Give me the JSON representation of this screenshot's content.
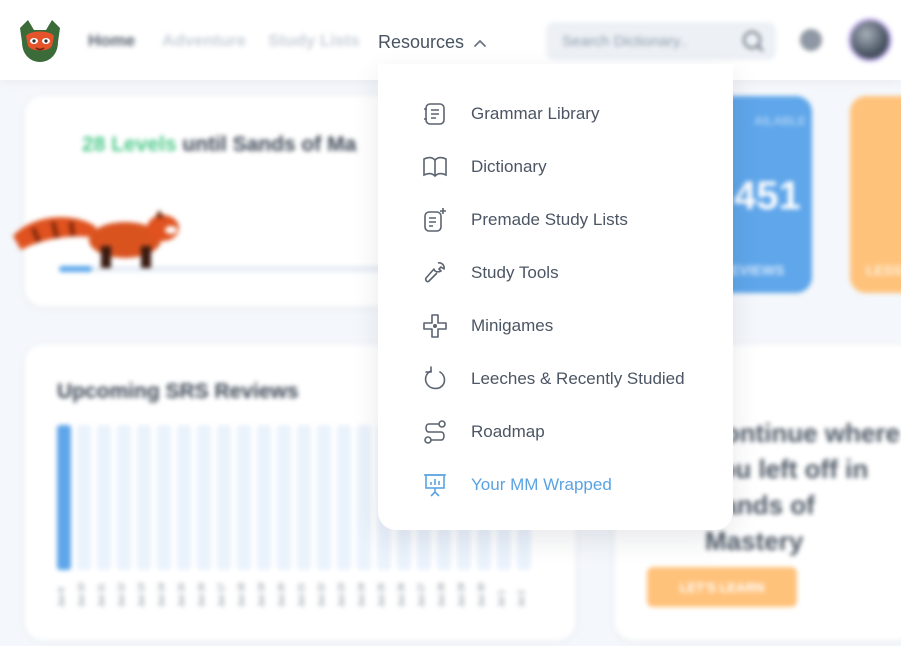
{
  "nav": {
    "home": "Home",
    "adventure": "Adventure",
    "study_lists": "Study Lists",
    "resources": "Resources",
    "search_placeholder": "Search Dictionary.."
  },
  "levels_card": {
    "levels_count": "28 Levels",
    "levels_rest": " until Sands of Ma",
    "progress": 0.1
  },
  "stats": {
    "blue_label": "AILABLE",
    "blue_number": "451",
    "blue_bottom": "EVIEWS",
    "orange_bottom": "LESS"
  },
  "srs": {
    "title": "Upcoming SRS Reviews",
    "dates": [
      "Jun 6",
      "Jun 10",
      "Jun 11",
      "Jun 12",
      "Jun 13",
      "Jun 14",
      "Jun 15",
      "Jun 16",
      "Jun 17",
      "Jun 18",
      "Jun 19",
      "Jun 20",
      "Jun 21",
      "Jun 22",
      "Jun 23",
      "Jun 24",
      "Jun 25",
      "Jun 26",
      "Jun 27",
      "Jun 28",
      "Jun 29",
      "Jun 30",
      "Jul 1",
      "Jul 2"
    ]
  },
  "continue_card": {
    "text": "Continue where you left off in Sands of Mastery",
    "button": "LET'S LEARN"
  },
  "dropdown": {
    "items": [
      {
        "label": "Grammar Library",
        "icon": "grammar-library-icon"
      },
      {
        "label": "Dictionary",
        "icon": "book-icon"
      },
      {
        "label": "Premade Study Lists",
        "icon": "list-add-icon"
      },
      {
        "label": "Study Tools",
        "icon": "wrench-icon"
      },
      {
        "label": "Minigames",
        "icon": "gamepad-icon"
      },
      {
        "label": "Leeches & Recently Studied",
        "icon": "refresh-icon"
      },
      {
        "label": "Roadmap",
        "icon": "route-icon"
      },
      {
        "label": "Your MM Wrapped",
        "icon": "presentation-chart-icon"
      }
    ],
    "highlight_color": "#5aa3e3"
  },
  "colors": {
    "accent_blue": "#5fa6ea",
    "accent_orange": "#ffc27b",
    "accent_green": "#4cc98a"
  }
}
